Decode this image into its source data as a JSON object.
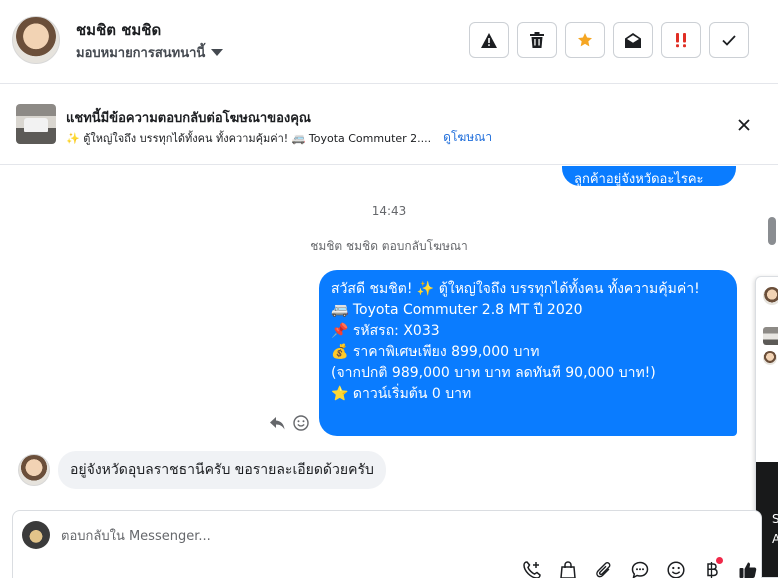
{
  "header": {
    "contact_name": "ชมชิต ชมชิด",
    "assign_label": "มอบหมายการสนทนานี้",
    "actions": [
      {
        "name": "spam-button",
        "icon": "warning-icon"
      },
      {
        "name": "delete-button",
        "icon": "trash-icon"
      },
      {
        "name": "star-button",
        "icon": "star-icon",
        "color": "#f5a623"
      },
      {
        "name": "mark-unread-button",
        "icon": "envelope-open-icon"
      },
      {
        "name": "follow-up-button",
        "icon": "double-exclamation-icon",
        "color": "#e02e24"
      },
      {
        "name": "mark-done-button",
        "icon": "checkmark-icon"
      }
    ]
  },
  "ad_banner": {
    "title": "แชทนี้มีข้อความตอบกลับต่อโฆษณาของคุณ",
    "snippet": "✨ ตู้ใหญ่ใจถึง บรรทุกได้ทั้งคน ทั้งความคุ้มค่า! 🚐 Toyota Commuter 2....",
    "link": "ดูโฆษณา"
  },
  "thread": {
    "top_bubble_text": "ลูกค้าอยู่จังหวัดอะไรคะ",
    "timestamp": "14:43",
    "reply_note": "ชมชิต ชมชิด ตอบกลับโฆษณา",
    "outgoing_lines": [
      "สวัสดี ชมชิต! ✨ ตู้ใหญ่ใจถึง บรรทุกได้ทั้งคน ทั้งความคุ้มค่า!",
      "🚐 Toyota Commuter 2.8 MT ปี 2020",
      " ",
      "📌 รหัสรถ: X033",
      "💰 ราคาพิเศษเพียง 899,000 บาท",
      "(จากปกติ 989,000 บาท บาท ลดทันที 90,000 บาท!)",
      "⭐ ดาวน์เริ่มต้น 0 บาท"
    ],
    "incoming_text": "อยู่จังหวัดอุบลราชธานีครับ ขอรายละเอียดด้วยครับ"
  },
  "side_panel": {
    "letter_s": "S",
    "letter_a": "A"
  },
  "composer": {
    "placeholder": "ตอบกลับใน Messenger...",
    "tools": [
      "add-contact-icon",
      "shopping-bag-icon",
      "paperclip-icon",
      "saved-reply-icon",
      "emoji-icon",
      "baht-payment-icon",
      "thumbs-up-icon"
    ]
  },
  "colors": {
    "accent": "#0a7cff",
    "link": "#216fdb",
    "star": "#f5a623",
    "alert": "#e02e24"
  }
}
